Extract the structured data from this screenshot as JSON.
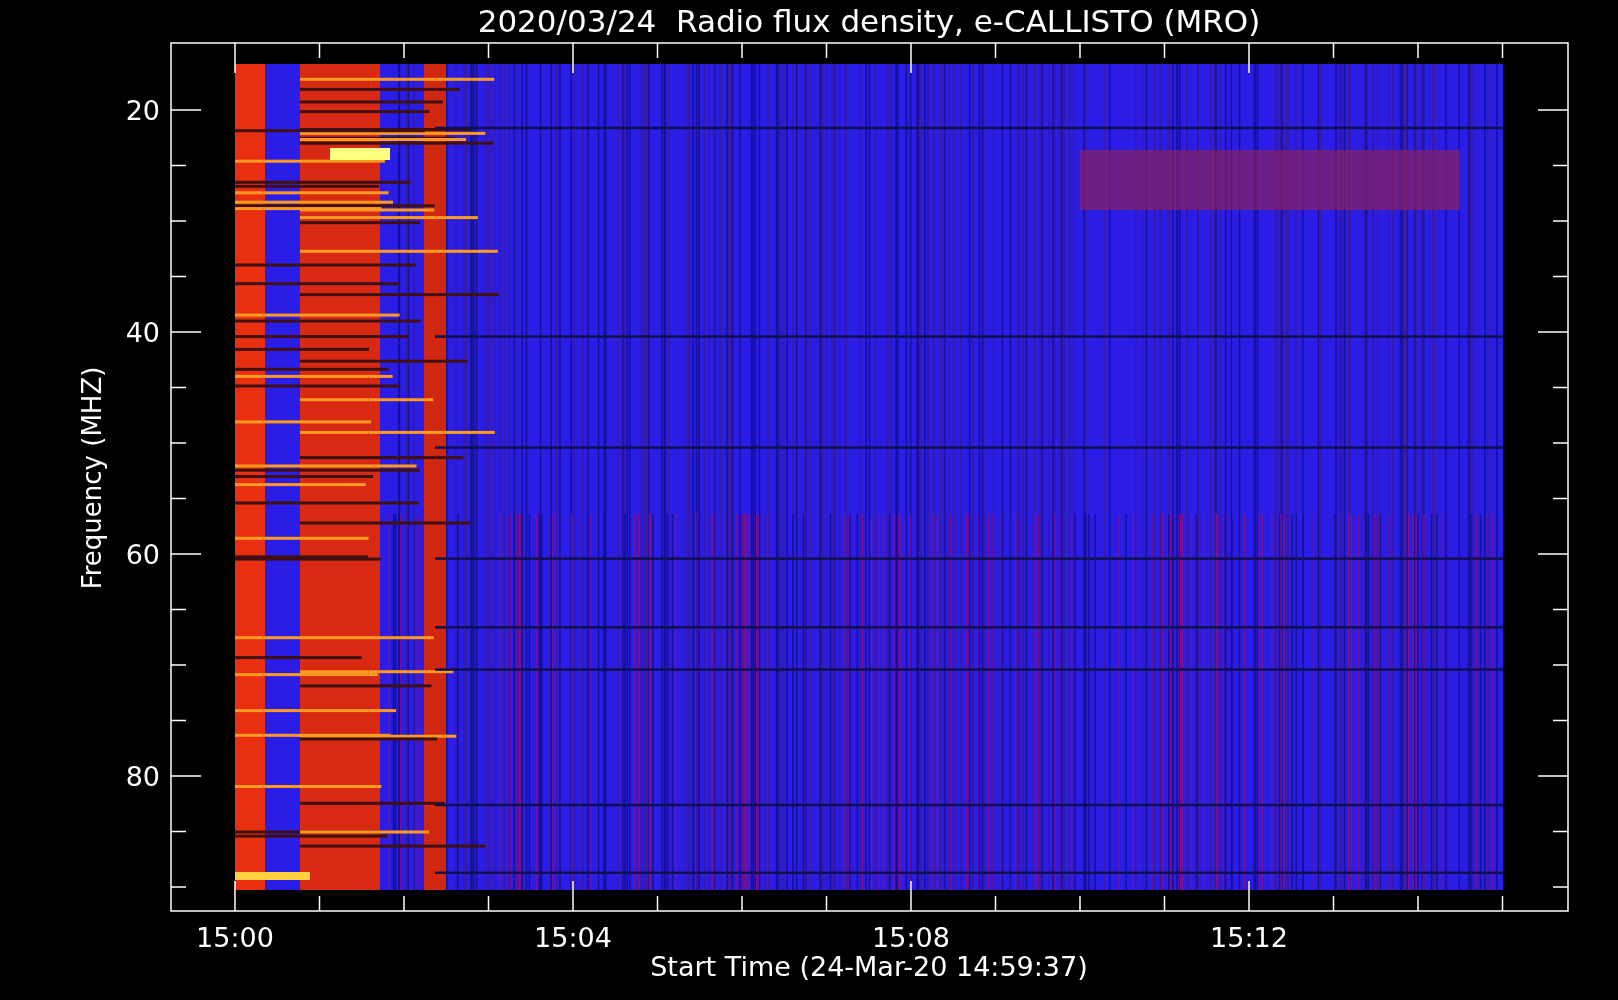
{
  "title": "2020/03/24  Radio flux density, e-CALLISTO (MRO)",
  "ylabel": "Frequency (MHZ)",
  "xlabel": "Start Time (24-Mar-20 14:59:37)",
  "yticks": [
    "20",
    "40",
    "60",
    "80"
  ],
  "xticks": [
    "15:00",
    "15:04",
    "15:08",
    "15:12"
  ]
}
